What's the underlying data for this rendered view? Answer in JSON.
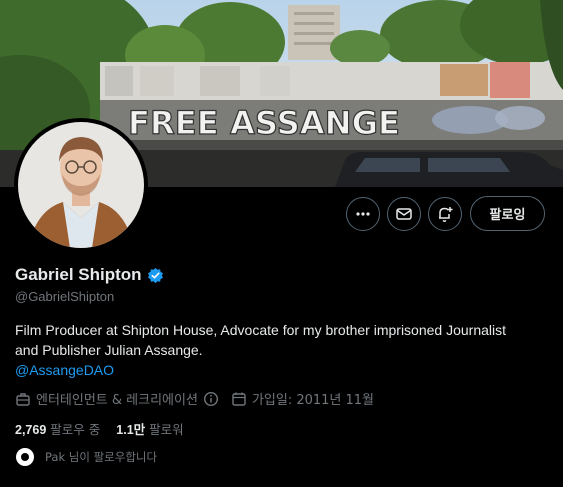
{
  "banner": {
    "graffiti_text": "FREE ASSANGE"
  },
  "actions": {
    "more_icon": "more-horizontal-icon",
    "message_icon": "envelope-icon",
    "notify_icon": "bell-plus-icon",
    "follow_label": "팔로잉"
  },
  "profile": {
    "display_name": "Gabriel Shipton",
    "handle": "@GabrielShipton",
    "verified_color": "#1d9bf0",
    "bio_line1": "Film Producer at Shipton House, Advocate for my brother imprisoned Journalist",
    "bio_line2": "and Publisher Julian Assange.",
    "bio_link": "@AssangeDAO"
  },
  "meta": {
    "category": "엔터테인먼트 & 레크리에이션",
    "joined": "가입일: 2011년 11월"
  },
  "stats": {
    "following_count": "2,769",
    "following_label": "팔로우 중",
    "followers_count": "1.1만",
    "followers_label": "팔로워"
  },
  "followed_by": {
    "text": "Pak 님이 팔로우합니다"
  }
}
